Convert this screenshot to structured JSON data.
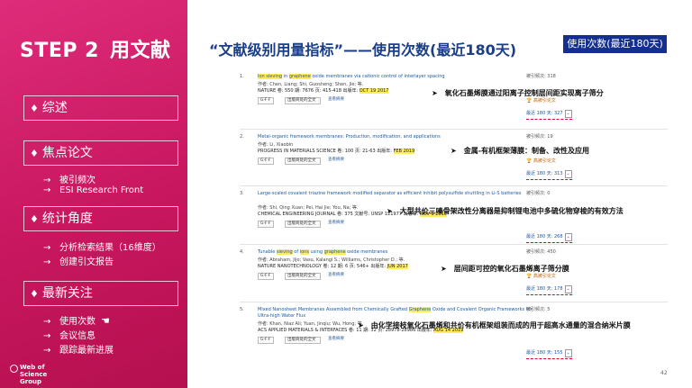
{
  "sidebar": {
    "step": "STEP 2",
    "title": "用文献",
    "sections": [
      {
        "label": "综述",
        "items": []
      },
      {
        "label": "焦点论文",
        "items": [
          "被引频次",
          "ESI Research Front"
        ]
      },
      {
        "label": "统计角度",
        "items": [
          "分析检索结果（16维度）",
          "创建引文报告"
        ]
      },
      {
        "label": "最新关注",
        "items": [
          "使用次数",
          "会议信息",
          "跟踪最新进展"
        ]
      }
    ],
    "logo": [
      "Web of",
      "Science",
      "Group"
    ]
  },
  "main": {
    "title": "“文献级别用量指标”——使用次数(最近180天)",
    "badge": "使用次数(最近180天)",
    "page_number": "42"
  },
  "records": [
    {
      "num": "1.",
      "title_parts": [
        {
          "t": "Ion sieving",
          "hl": true
        },
        {
          "t": " in ",
          "hl": false
        },
        {
          "t": "graphene",
          "hl": true
        },
        {
          "t": " oxide membranes via cationic control of interlayer spacing",
          "hl": false
        }
      ],
      "authors": "作者: Chen, Liang; Shi, Guosheng; Shen, Jie; 等.",
      "source": "NATURE  卷: 550  期: 7676  页: 415-418  出版年: ",
      "date": "OCT 19 2017",
      "cited": "被引频次: 318",
      "hot": "高被引论文",
      "usage": "最近 180 天: 327",
      "callout": "氧化石墨烯膜通过阳离子控制层间距实现离子筛分"
    },
    {
      "num": "2.",
      "title_parts": [
        {
          "t": "Metal-organic framework membranes: Production, modification, and applications",
          "hl": false
        }
      ],
      "authors": "作者: Li, Xiaobin",
      "source": "PROGRESS IN MATERIALS SCIENCE  卷: 100  页: 21-63  出版年: ",
      "date": "FEB 2019",
      "cited": "被引频次: 19",
      "hot": "高被引论文",
      "usage": "最近 180 天: 313",
      "callout": "金属-有机框架薄膜：制备、改性及应用"
    },
    {
      "num": "3.",
      "title_parts": [
        {
          "t": "Large-scaled covalent triazine framework modified separator as efficient inhibit polysulfide shuttling in Li-S batteries",
          "hl": false
        }
      ],
      "authors": "作者: Shi, Qing Xuan; Pei, Hai Jie; You, Na; 等.",
      "source": "CHEMICAL ENGINEERING JOURNAL  卷: 375  文献号: UNSP 121977  出版年: ",
      "date": "NOV 1 2019",
      "cited": "被引频次: 0",
      "hot": "",
      "usage": "最近 180 天: 268",
      "callout": "大型共价三嗪骨架改性分离器是抑制锂电池中多硫化物穿梭的有效方法"
    },
    {
      "num": "4.",
      "title_parts": [
        {
          "t": "Tunable ",
          "hl": false
        },
        {
          "t": "sieving",
          "hl": true
        },
        {
          "t": " of ",
          "hl": false
        },
        {
          "t": "ions",
          "hl": true
        },
        {
          "t": " using ",
          "hl": false
        },
        {
          "t": "graphene",
          "hl": true
        },
        {
          "t": " oxide membranes",
          "hl": false
        }
      ],
      "authors": "作者: Abraham, Jijo; Vasu, Kalangi S.; Williams, Christopher D.; 等.",
      "source": "NATURE NANOTECHNOLOGY  卷: 12  期: 6  页: 546+  出版年: ",
      "date": "JUN 2017",
      "cited": "被引频次: 450",
      "hot": "高被引论文",
      "usage": "最近 180 天: 178",
      "callout": "层间距可控的氧化石墨烯离子筛分膜"
    },
    {
      "num": "5.",
      "title_parts": [
        {
          "t": "Mixed Nanosheet Membranes Assembled from Chemically Grafted ",
          "hl": false
        },
        {
          "t": "Graphene",
          "hl": true
        },
        {
          "t": " Oxide and Covalent Organic Frameworks for Ultra-high Water Flux",
          "hl": false
        }
      ],
      "authors": "作者: Khan, Niaz Ali; Yuan, Jinqiu; Wu, Hong; 等.",
      "source": "ACS APPLIED MATERIALS & INTERFACES  卷: 11  期: 32  页: 28978-28986  出版年: ",
      "date": "AUG 14 2019",
      "cited": "被引频次: 5",
      "hot": "",
      "usage": "最近 180 天: 155",
      "callout": "由化学接枝氧化石墨烯和共价有机框架组装而成的用于超高水通量的混合纳米片膜"
    }
  ],
  "ui": {
    "fulltext_btn": "出版商处的全文",
    "abstract_link": "查看摘要",
    "gofulltext": "G·F·F",
    "callout_marker": "➤",
    "sub_marker": "→",
    "bullet": "♦",
    "hand": "☚"
  },
  "colors": {
    "sidebar": "#d22068",
    "title": "#1a3e88",
    "badge": "#142f8c",
    "highlight": "#ffec5c"
  }
}
